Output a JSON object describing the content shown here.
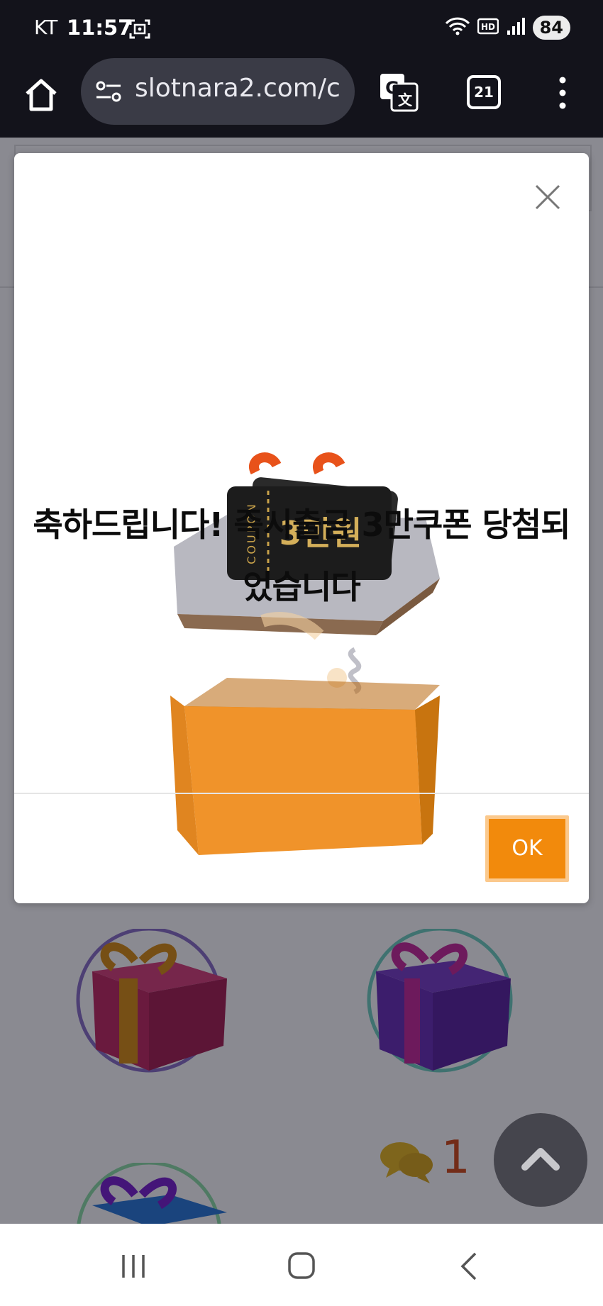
{
  "status_bar": {
    "carrier": "KT",
    "time": "11:57",
    "battery": "84",
    "icons": [
      "screenshot-icon",
      "wifi-icon",
      "hd-icon",
      "signal-icon",
      "battery-icon"
    ]
  },
  "browser": {
    "url": "slotnara2.com/c",
    "tab_count": "21",
    "icons": [
      "home-icon",
      "site-settings-icon",
      "translate-icon",
      "tabs-icon",
      "more-menu-icon"
    ]
  },
  "modal": {
    "coupon_label": "COUPON",
    "coupon_amount": "3만원",
    "message": "축하드립니다! 즉시출금 3만쿠폰 당첨되었습니다",
    "ok_label": "OK",
    "colors": {
      "ok_button": "#f28a0c",
      "ok_border": "#fbc98d",
      "box": "#ef9325"
    }
  },
  "background_page": {
    "chat_count": "1",
    "colors": {
      "chat_count": "#d34b17"
    }
  },
  "nav": {
    "icons": [
      "recent-apps-icon",
      "home-circle-icon",
      "back-icon"
    ]
  }
}
